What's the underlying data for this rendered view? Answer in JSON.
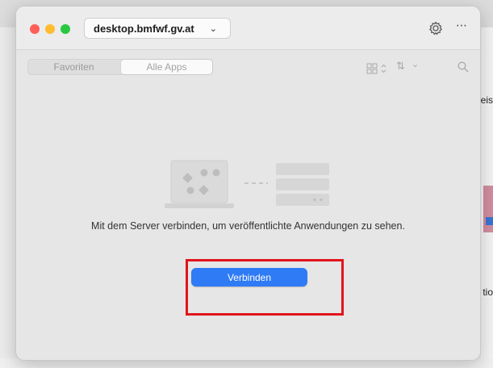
{
  "window": {
    "server": "desktop.bmfwf.gv.at",
    "segments": {
      "favorites": "Favoriten",
      "all_apps": "Alle Apps"
    },
    "empty_state": {
      "message": "Mit dem Server verbinden, um veröffentlichte Anwendungen zu sehen.",
      "connect_label": "Verbinden"
    }
  },
  "background": {
    "text_top": "eis",
    "text_bottom": "tio"
  },
  "colors": {
    "accent": "#2f7bf5",
    "highlight": "#e1141c"
  },
  "icons": [
    "gear-icon",
    "more-icon",
    "chevron-down-icon",
    "grid-view-icon",
    "sort-icon",
    "search-icon"
  ]
}
